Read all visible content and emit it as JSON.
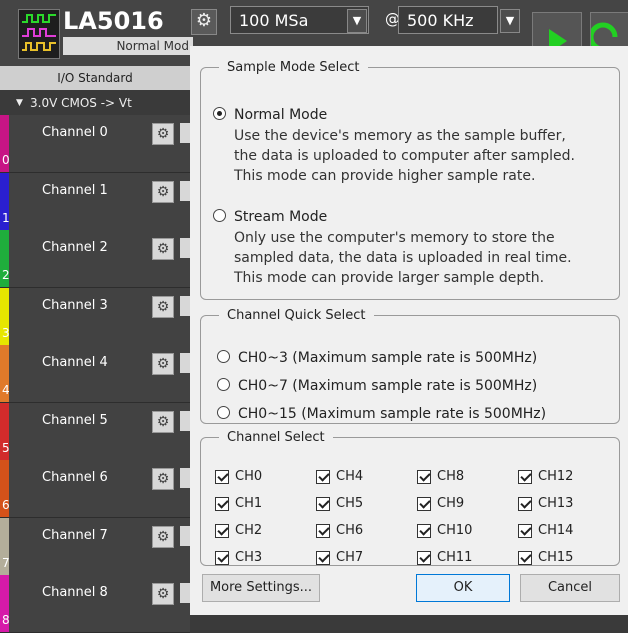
{
  "toolbar": {
    "device_name": "LA5016",
    "device_mode": "Normal Mod",
    "sample_rate": "100 MSa",
    "at": "@",
    "frequency": "500 KHz"
  },
  "left_panel": {
    "io_standard_header": "I/O Standard",
    "io_standard_value": "3.0V CMOS -> Vt",
    "channels": [
      {
        "label": "Channel 0",
        "num": "0",
        "color": "#c71585"
      },
      {
        "label": "Channel 1",
        "num": "1",
        "color": "#2a1fd0"
      },
      {
        "label": "Channel 2",
        "num": "2",
        "color": "#1fae3c"
      },
      {
        "label": "Channel 3",
        "num": "3",
        "color": "#e6e600"
      },
      {
        "label": "Channel 4",
        "num": "4",
        "color": "#e07a2a"
      },
      {
        "label": "Channel 5",
        "num": "5",
        "color": "#d22b2b"
      },
      {
        "label": "Channel 6",
        "num": "6",
        "color": "#d4521a"
      },
      {
        "label": "Channel 7",
        "num": "7",
        "color": "#b3ae9a"
      },
      {
        "label": "Channel 8",
        "num": "8",
        "color": "#d61aa9"
      }
    ]
  },
  "dialog": {
    "sample_mode": {
      "title": "Sample Mode Select",
      "normal": {
        "label": "Normal Mode",
        "checked": true,
        "description": "Use the device's memory as the sample buffer,\nthe data is uploaded to computer after sampled.\nThis mode can provide higher sample rate."
      },
      "stream": {
        "label": "Stream Mode",
        "checked": false,
        "description": "Only use the computer's memory to store the\nsampled data, the data is uploaded in real time.\nThis mode can provide larger sample depth."
      }
    },
    "quick_select": {
      "title": "Channel Quick Select",
      "options": [
        "CH0~3 (Maximum sample rate is 500MHz)",
        "CH0~7 (Maximum sample rate is 500MHz)",
        "CH0~15 (Maximum sample rate is 500MHz)"
      ]
    },
    "channel_select": {
      "title": "Channel Select",
      "channels": [
        "CH0",
        "CH1",
        "CH2",
        "CH3",
        "CH4",
        "CH5",
        "CH6",
        "CH7",
        "CH8",
        "CH9",
        "CH10",
        "CH11",
        "CH12",
        "CH13",
        "CH14",
        "CH15"
      ]
    },
    "buttons": {
      "more": "More Settings...",
      "ok": "OK",
      "cancel": "Cancel"
    }
  }
}
